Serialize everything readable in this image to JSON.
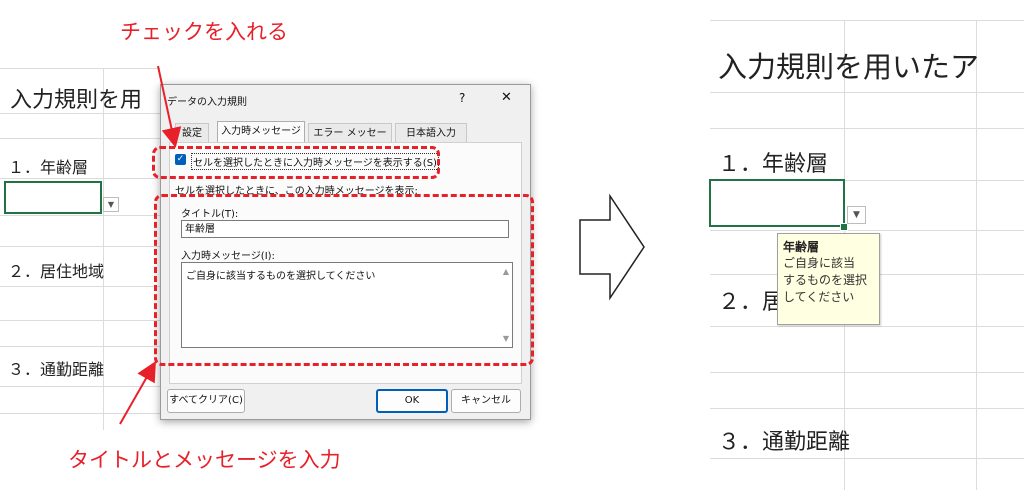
{
  "annotations": {
    "check_label": "チェックを入れる",
    "input_label": "タイトルとメッセージを入力"
  },
  "left_sheet": {
    "heading": "入力規則を用",
    "item1": "１．年齢層",
    "item2": "２．居住地域",
    "item3": "３．通勤距離"
  },
  "dialog": {
    "title": "データの入力規則",
    "help": "?",
    "close": "✕",
    "tabs": [
      "設定",
      "入力時メッセージ",
      "エラー メッセージ",
      "日本語入力"
    ],
    "checkbox_label": "セルを選択したときに入力時メッセージを表示する(S)",
    "group_label": "セルを選択したときに、この入力時メッセージを表示:",
    "title_field_label": "タイトル(T):",
    "title_value": "年齢層",
    "message_field_label": "入力時メッセージ(I):",
    "message_value": "ご自身に該当するものを選択してください",
    "clear_all": "すべてクリア(C)",
    "ok": "OK",
    "cancel": "キャンセル"
  },
  "right_sheet": {
    "heading": "入力規則を用いたア",
    "item1": "１．年齢層",
    "item2": "２．居",
    "item3": "３．通勤距離",
    "tooltip_title": "年齢層",
    "tooltip_lines": [
      "ご自身に該当",
      "するものを選択",
      "してください"
    ]
  },
  "colors": {
    "annotation": "#e8202a",
    "selection": "#217346",
    "tooltip_bg": "#ffffe1"
  }
}
